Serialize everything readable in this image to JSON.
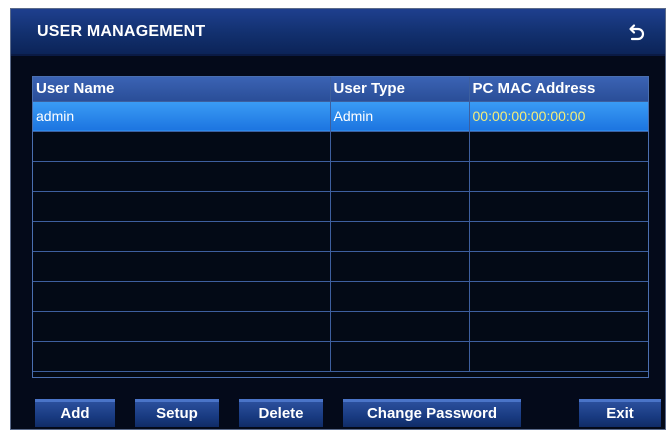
{
  "header": {
    "title": "USER MANAGEMENT",
    "back_icon": "return-arrow-icon"
  },
  "table": {
    "columns": [
      "User Name",
      "User Type",
      "PC MAC Address"
    ],
    "rows": [
      {
        "user_name": "admin",
        "user_type": "Admin",
        "mac": "00:00:00:00:00:00",
        "selected": true
      },
      {
        "user_name": "",
        "user_type": "",
        "mac": ""
      },
      {
        "user_name": "",
        "user_type": "",
        "mac": ""
      },
      {
        "user_name": "",
        "user_type": "",
        "mac": ""
      },
      {
        "user_name": "",
        "user_type": "",
        "mac": ""
      },
      {
        "user_name": "",
        "user_type": "",
        "mac": ""
      },
      {
        "user_name": "",
        "user_type": "",
        "mac": ""
      },
      {
        "user_name": "",
        "user_type": "",
        "mac": ""
      },
      {
        "user_name": "",
        "user_type": "",
        "mac": ""
      }
    ]
  },
  "buttons": {
    "add": "Add",
    "setup": "Setup",
    "delete": "Delete",
    "change_password": "Change Password",
    "exit": "Exit"
  },
  "colors": {
    "background": "#040a1a",
    "header_bar": "#1e3f8e",
    "selected_row": "#2a86ec",
    "mac_text": "#f5ee7a",
    "grid_line": "#3d5f9e"
  }
}
